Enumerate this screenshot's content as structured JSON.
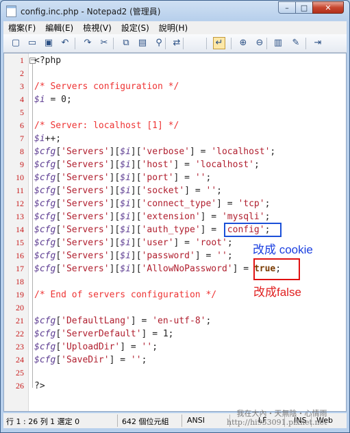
{
  "window": {
    "title": "config.inc.php - Notepad2 (管理員)",
    "controls": {
      "minimize": "–",
      "maximize": "□",
      "close": "✕"
    }
  },
  "menu": [
    "檔案(F)",
    "編輯(E)",
    "檢視(V)",
    "設定(S)",
    "說明(H)"
  ],
  "toolbar": {
    "icons": [
      "new-icon",
      "open-icon",
      "save-icon",
      "undo-icon",
      "redo-icon",
      "cut-icon",
      "copy-icon",
      "paste-icon",
      "find-icon",
      "replace-icon",
      "word-wrap-icon",
      "zoom-in-icon",
      "zoom-out-icon",
      "settings-icon",
      "scheme-icon",
      "exit-icon"
    ],
    "glyphs": [
      "▢",
      "▭",
      "▣",
      "↶",
      "↷",
      "✂",
      "⧉",
      "▤",
      "⚲",
      "⇄",
      "↵",
      "⊕",
      "⊖",
      "▥",
      "✎",
      "⇥"
    ]
  },
  "editor": {
    "lines": [
      {
        "num": "1",
        "parts": [
          {
            "t": "<?php",
            "c": "txt"
          }
        ]
      },
      {
        "num": "2",
        "parts": []
      },
      {
        "num": "3",
        "parts": [
          {
            "t": "/* Servers configuration */",
            "c": "com"
          }
        ]
      },
      {
        "num": "4",
        "parts": [
          {
            "t": "$i",
            "c": "var"
          },
          {
            "t": " = 0;",
            "c": "txt"
          }
        ]
      },
      {
        "num": "5",
        "parts": []
      },
      {
        "num": "6",
        "parts": [
          {
            "t": "/* Server: localhost [1] */",
            "c": "com"
          }
        ]
      },
      {
        "num": "7",
        "parts": [
          {
            "t": "$i",
            "c": "var"
          },
          {
            "t": "++;",
            "c": "txt"
          }
        ]
      },
      {
        "num": "8",
        "parts": [
          {
            "t": "$cfg",
            "c": "var"
          },
          {
            "t": "[",
            "c": "txt"
          },
          {
            "t": "'Servers'",
            "c": "str"
          },
          {
            "t": "][",
            "c": "txt"
          },
          {
            "t": "$i",
            "c": "var"
          },
          {
            "t": "][",
            "c": "txt"
          },
          {
            "t": "'verbose'",
            "c": "str"
          },
          {
            "t": "] = ",
            "c": "txt"
          },
          {
            "t": "'localhost'",
            "c": "str"
          },
          {
            "t": ";",
            "c": "txt"
          }
        ]
      },
      {
        "num": "9",
        "parts": [
          {
            "t": "$cfg",
            "c": "var"
          },
          {
            "t": "[",
            "c": "txt"
          },
          {
            "t": "'Servers'",
            "c": "str"
          },
          {
            "t": "][",
            "c": "txt"
          },
          {
            "t": "$i",
            "c": "var"
          },
          {
            "t": "][",
            "c": "txt"
          },
          {
            "t": "'host'",
            "c": "str"
          },
          {
            "t": "] = ",
            "c": "txt"
          },
          {
            "t": "'localhost'",
            "c": "str"
          },
          {
            "t": ";",
            "c": "txt"
          }
        ]
      },
      {
        "num": "10",
        "parts": [
          {
            "t": "$cfg",
            "c": "var"
          },
          {
            "t": "[",
            "c": "txt"
          },
          {
            "t": "'Servers'",
            "c": "str"
          },
          {
            "t": "][",
            "c": "txt"
          },
          {
            "t": "$i",
            "c": "var"
          },
          {
            "t": "][",
            "c": "txt"
          },
          {
            "t": "'port'",
            "c": "str"
          },
          {
            "t": "] = ",
            "c": "txt"
          },
          {
            "t": "''",
            "c": "str"
          },
          {
            "t": ";",
            "c": "txt"
          }
        ]
      },
      {
        "num": "11",
        "parts": [
          {
            "t": "$cfg",
            "c": "var"
          },
          {
            "t": "[",
            "c": "txt"
          },
          {
            "t": "'Servers'",
            "c": "str"
          },
          {
            "t": "][",
            "c": "txt"
          },
          {
            "t": "$i",
            "c": "var"
          },
          {
            "t": "][",
            "c": "txt"
          },
          {
            "t": "'socket'",
            "c": "str"
          },
          {
            "t": "] = ",
            "c": "txt"
          },
          {
            "t": "''",
            "c": "str"
          },
          {
            "t": ";",
            "c": "txt"
          }
        ]
      },
      {
        "num": "12",
        "parts": [
          {
            "t": "$cfg",
            "c": "var"
          },
          {
            "t": "[",
            "c": "txt"
          },
          {
            "t": "'Servers'",
            "c": "str"
          },
          {
            "t": "][",
            "c": "txt"
          },
          {
            "t": "$i",
            "c": "var"
          },
          {
            "t": "][",
            "c": "txt"
          },
          {
            "t": "'connect_type'",
            "c": "str"
          },
          {
            "t": "] = ",
            "c": "txt"
          },
          {
            "t": "'tcp'",
            "c": "str"
          },
          {
            "t": ";",
            "c": "txt"
          }
        ]
      },
      {
        "num": "13",
        "parts": [
          {
            "t": "$cfg",
            "c": "var"
          },
          {
            "t": "[",
            "c": "txt"
          },
          {
            "t": "'Servers'",
            "c": "str"
          },
          {
            "t": "][",
            "c": "txt"
          },
          {
            "t": "$i",
            "c": "var"
          },
          {
            "t": "][",
            "c": "txt"
          },
          {
            "t": "'extension'",
            "c": "str"
          },
          {
            "t": "] = ",
            "c": "txt"
          },
          {
            "t": "'mysqli'",
            "c": "str"
          },
          {
            "t": ";",
            "c": "txt"
          }
        ]
      },
      {
        "num": "14",
        "parts": [
          {
            "t": "$cfg",
            "c": "var"
          },
          {
            "t": "[",
            "c": "txt"
          },
          {
            "t": "'Servers'",
            "c": "str"
          },
          {
            "t": "][",
            "c": "txt"
          },
          {
            "t": "$i",
            "c": "var"
          },
          {
            "t": "][",
            "c": "txt"
          },
          {
            "t": "'auth_type'",
            "c": "str"
          },
          {
            "t": "] = ",
            "c": "txt"
          },
          {
            "t": "'config'",
            "c": "str"
          },
          {
            "t": ";",
            "c": "txt"
          }
        ]
      },
      {
        "num": "15",
        "parts": [
          {
            "t": "$cfg",
            "c": "var"
          },
          {
            "t": "[",
            "c": "txt"
          },
          {
            "t": "'Servers'",
            "c": "str"
          },
          {
            "t": "][",
            "c": "txt"
          },
          {
            "t": "$i",
            "c": "var"
          },
          {
            "t": "][",
            "c": "txt"
          },
          {
            "t": "'user'",
            "c": "str"
          },
          {
            "t": "] = ",
            "c": "txt"
          },
          {
            "t": "'root'",
            "c": "str"
          },
          {
            "t": ";",
            "c": "txt"
          }
        ]
      },
      {
        "num": "16",
        "parts": [
          {
            "t": "$cfg",
            "c": "var"
          },
          {
            "t": "[",
            "c": "txt"
          },
          {
            "t": "'Servers'",
            "c": "str"
          },
          {
            "t": "][",
            "c": "txt"
          },
          {
            "t": "$i",
            "c": "var"
          },
          {
            "t": "][",
            "c": "txt"
          },
          {
            "t": "'password'",
            "c": "str"
          },
          {
            "t": "] = ",
            "c": "txt"
          },
          {
            "t": "''",
            "c": "str"
          },
          {
            "t": ";",
            "c": "txt"
          }
        ]
      },
      {
        "num": "17",
        "parts": [
          {
            "t": "$cfg",
            "c": "var"
          },
          {
            "t": "[",
            "c": "txt"
          },
          {
            "t": "'Servers'",
            "c": "str"
          },
          {
            "t": "][",
            "c": "txt"
          },
          {
            "t": "$i",
            "c": "var"
          },
          {
            "t": "][",
            "c": "txt"
          },
          {
            "t": "'AllowNoPassword'",
            "c": "str"
          },
          {
            "t": "] = ",
            "c": "txt"
          },
          {
            "t": "true",
            "c": "kw"
          },
          {
            "t": ";",
            "c": "txt"
          }
        ]
      },
      {
        "num": "18",
        "parts": []
      },
      {
        "num": "19",
        "parts": [
          {
            "t": "/* End of servers configuration */",
            "c": "com"
          }
        ]
      },
      {
        "num": "20",
        "parts": []
      },
      {
        "num": "21",
        "parts": [
          {
            "t": "$cfg",
            "c": "var"
          },
          {
            "t": "[",
            "c": "txt"
          },
          {
            "t": "'DefaultLang'",
            "c": "str"
          },
          {
            "t": "] = ",
            "c": "txt"
          },
          {
            "t": "'en-utf-8'",
            "c": "str"
          },
          {
            "t": ";",
            "c": "txt"
          }
        ]
      },
      {
        "num": "22",
        "parts": [
          {
            "t": "$cfg",
            "c": "var"
          },
          {
            "t": "[",
            "c": "txt"
          },
          {
            "t": "'ServerDefault'",
            "c": "str"
          },
          {
            "t": "] = 1;",
            "c": "txt"
          }
        ]
      },
      {
        "num": "23",
        "parts": [
          {
            "t": "$cfg",
            "c": "var"
          },
          {
            "t": "[",
            "c": "txt"
          },
          {
            "t": "'UploadDir'",
            "c": "str"
          },
          {
            "t": "] = ",
            "c": "txt"
          },
          {
            "t": "''",
            "c": "str"
          },
          {
            "t": ";",
            "c": "txt"
          }
        ]
      },
      {
        "num": "24",
        "parts": [
          {
            "t": "$cfg",
            "c": "var"
          },
          {
            "t": "[",
            "c": "txt"
          },
          {
            "t": "'SaveDir'",
            "c": "str"
          },
          {
            "t": "] = ",
            "c": "txt"
          },
          {
            "t": "''",
            "c": "str"
          },
          {
            "t": ";",
            "c": "txt"
          }
        ]
      },
      {
        "num": "25",
        "parts": []
      },
      {
        "num": "26",
        "parts": [
          {
            "t": "?>",
            "c": "txt"
          }
        ]
      }
    ]
  },
  "annotations": {
    "change_to_cookie": "改成 cookie",
    "change_to_false": "改成false"
  },
  "status": {
    "position": "行 1 : 26   列 1   選定 0",
    "size": "642 個位元組",
    "encoding": "ANSI",
    "eol": "LF",
    "mode": "INS",
    "scheme": "Web"
  },
  "watermark": {
    "line1": "我在大內・天無陰・心情雨",
    "line2": "http://hi953091.pixnet.net"
  },
  "colors": {
    "comment": "#ee3333",
    "variable": "#5b3a90",
    "string": "#b01e2e",
    "keyword": "#7a3a00",
    "line_number": "#c81a1a",
    "annotation_blue": "#1a3fe0",
    "annotation_red": "#e02020"
  }
}
